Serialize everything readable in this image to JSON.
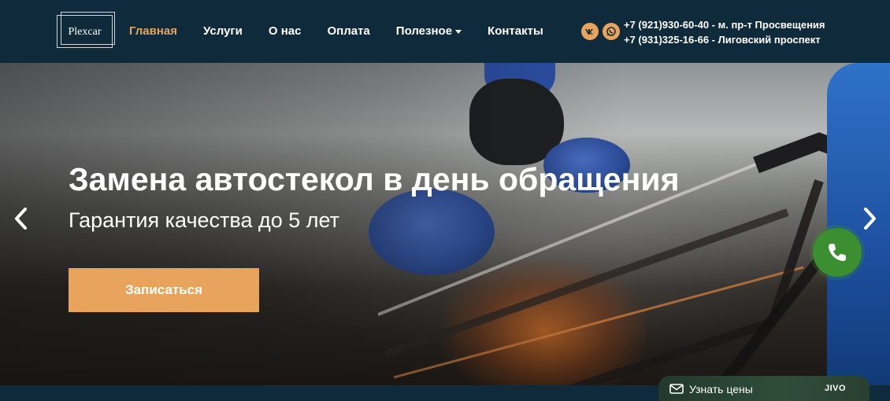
{
  "header": {
    "logo_text": "Plexcar",
    "nav": [
      {
        "label": "Главная",
        "active": true
      },
      {
        "label": "Услуги",
        "active": false
      },
      {
        "label": "О нас",
        "active": false
      },
      {
        "label": "Оплата",
        "active": false
      },
      {
        "label": "Полезное",
        "active": false,
        "has_dropdown": true
      },
      {
        "label": "Контакты",
        "active": false
      }
    ],
    "social": [
      {
        "name": "vk-icon",
        "label": "VK"
      },
      {
        "name": "whatsapp-icon"
      }
    ],
    "phones": [
      "+7 (921)930-60-40 - м. пр-т Просвещения",
      "+7 (931)325-16-66 - Лиговский проспект"
    ]
  },
  "hero": {
    "title": "Замена автостекол в день обращения",
    "subtitle": "Гарантия качества до 5 лет",
    "cta_label": "Записаться"
  },
  "widgets": {
    "jivo_label": "Узнать цены",
    "jivo_brand": "JIVO"
  },
  "colors": {
    "header_bg": "#0f2a3b",
    "accent": "#e8a45c",
    "call_button": "#3c8f31"
  }
}
